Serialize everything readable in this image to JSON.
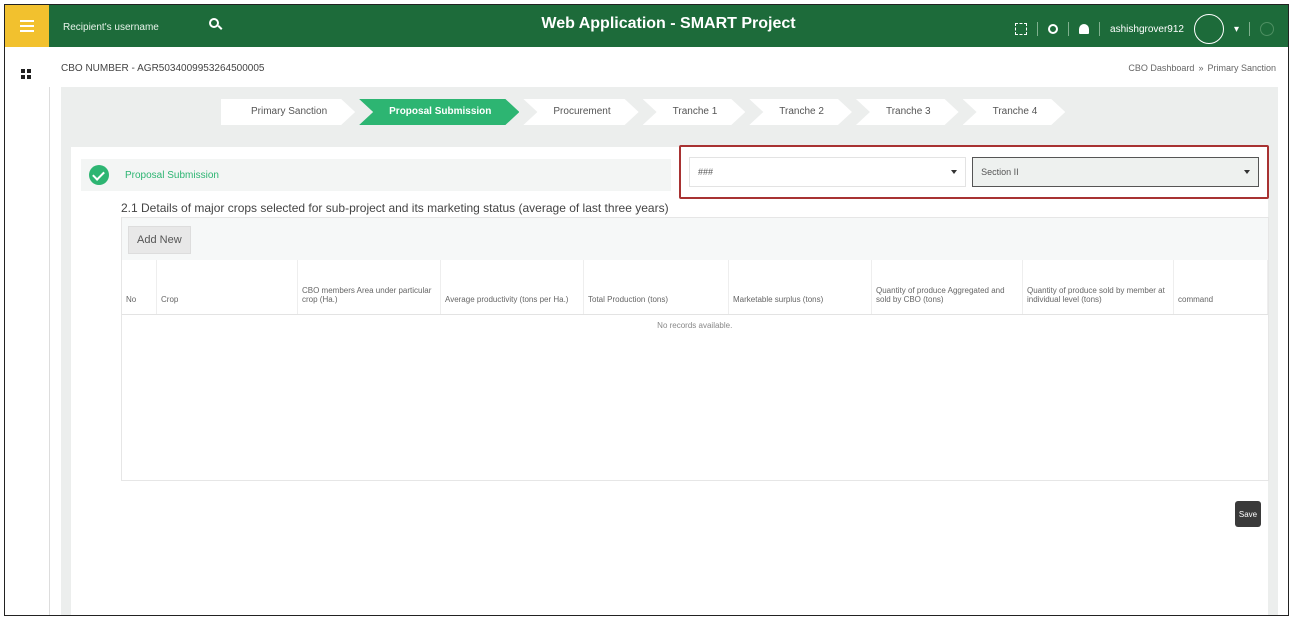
{
  "header": {
    "search_placeholder": "Recipient's username",
    "app_title": "Web Application - SMART Project",
    "username": "ashishgrover912"
  },
  "subheader": {
    "cbo_number": "CBO NUMBER - AGR5034009953264500005",
    "breadcrumb": [
      "CBO Dashboard",
      "»",
      "Primary Sanction"
    ]
  },
  "stepper": {
    "steps": [
      "Primary Sanction",
      "Proposal Submission",
      "Procurement",
      "Tranche 1",
      "Tranche 2",
      "Tranche 3",
      "Tranche 4"
    ],
    "active_index": 1
  },
  "section": {
    "title": "Proposal Submission",
    "select_1_value": "###",
    "select_2_value": "Section II",
    "subtitle": "2.1 Details of major crops selected for sub-project and its marketing status (average of last three years)"
  },
  "table": {
    "add_button": "Add New",
    "columns": [
      "No",
      "Crop",
      "CBO members Area under particular crop (Ha.)",
      "Average productivity (tons per Ha.)",
      "Total Production (tons)",
      "Marketable surplus (tons)",
      "Quantity of produce Aggregated and sold by CBO (tons)",
      "Quantity of produce sold by member at individual level (tons)",
      "command"
    ],
    "empty_message": "No records available."
  },
  "actions": {
    "save_label": "Save"
  },
  "colors": {
    "topbar": "#1d6b3a",
    "accent": "#2db572",
    "hamburger": "#f2c12e",
    "highlight_border": "#a83232"
  }
}
